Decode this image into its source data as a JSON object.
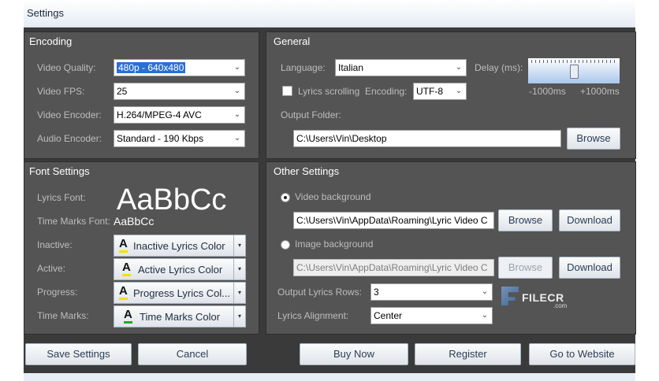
{
  "window": {
    "title": "Settings"
  },
  "encoding": {
    "title": "Encoding",
    "video_quality_label": "Video Quality:",
    "video_quality_value": "480p - 640x480",
    "video_fps_label": "Video FPS:",
    "video_fps_value": "25",
    "video_encoder_label": "Video Encoder:",
    "video_encoder_value": "H.264/MPEG-4 AVC",
    "audio_encoder_label": "Audio Encoder:",
    "audio_encoder_value": "Standard - 190 Kbps"
  },
  "general": {
    "title": "General",
    "language_label": "Language:",
    "language_value": "Italian",
    "delay_label": "Delay (ms):",
    "delay_min": "-1000ms",
    "delay_max": "+1000ms",
    "delay_level": 0.5,
    "lyrics_scrolling_label": "Lyrics scrolling",
    "lyrics_scrolling_checked": false,
    "encoding_label": "Encoding:",
    "encoding_value": "UTF-8",
    "output_folder_label": "Output Folder:",
    "output_folder_value": "C:\\Users\\Vin\\Desktop",
    "browse_label": "Browse"
  },
  "font_settings": {
    "title": "Font Settings",
    "lyrics_font_label": "Lyrics Font:",
    "lyrics_font_sample": "AaBbCc",
    "time_marks_font_label": "Time Marks Font:",
    "time_marks_font_sample": "AaBbCc",
    "inactive_label": "Inactive:",
    "inactive_button": "Inactive Lyrics Color",
    "active_label": "Active:",
    "active_button": "Active Lyrics Color",
    "progress_label": "Progress:",
    "progress_button": "Progress  Lyrics Col...",
    "time_marks_label": "Time Marks:",
    "time_marks_button": "Time Marks Color",
    "color_glyph": "A"
  },
  "other_settings": {
    "title": "Other Settings",
    "video_background_label": "Video background",
    "video_background_path": "C:\\Users\\Vin\\AppData\\Roaming\\Lyric Video C",
    "video_browse": "Browse",
    "video_download": "Download",
    "image_background_label": "Image background",
    "image_background_path": "C:\\Users\\Vin\\AppData\\Roaming\\Lyric Video C",
    "image_browse": "Browse",
    "image_download": "Download",
    "output_rows_label": "Output Lyrics Rows:",
    "output_rows_value": "3",
    "alignment_label": "Lyrics Alignment:",
    "alignment_value": "Center"
  },
  "footer": {
    "save_settings": "Save Settings",
    "cancel": "Cancel",
    "buy_now": "Buy Now",
    "register": "Register",
    "go_to_website": "Go to Website"
  },
  "watermark": {
    "text": "FILECR",
    "sub": ".com"
  },
  "icons": {
    "chevron": "chevron-down-icon",
    "dropdown_arrow": "small-triangle-down-icon"
  },
  "colors": {
    "selection": "#2a6fd3",
    "inactive_underline": "#f2e000",
    "active_underline": "#f2e000",
    "progress_underline": "#f2e000",
    "time_marks_underline": "#22aa22"
  }
}
